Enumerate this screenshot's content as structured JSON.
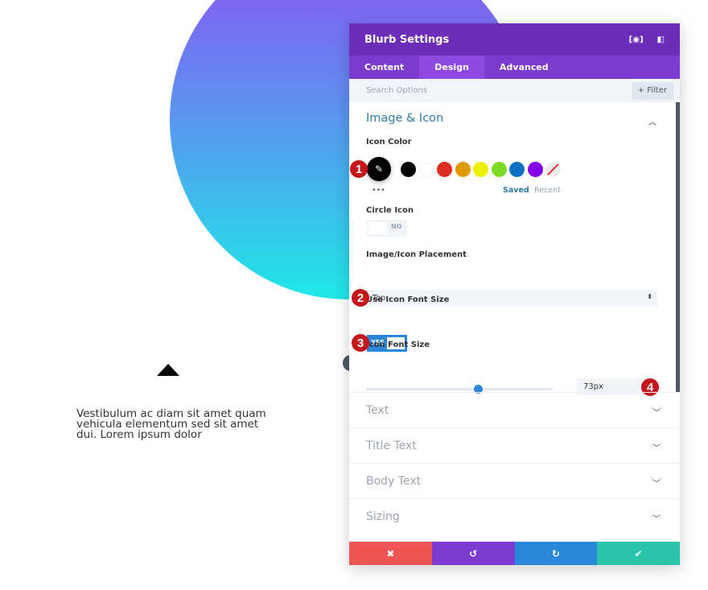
{
  "canvas": {
    "body_text": "Vestibulum ac diam sit amet quam vehicula elementum sed sit amet dui. Lorem ipsum dolor",
    "gradient_colors": [
      "#8f4ff5",
      "#1ee9e8"
    ]
  },
  "panel": {
    "title": "Blurb Settings",
    "header_icons": [
      "fullscreen-icon",
      "sidebar-toggle-icon"
    ],
    "tabs": [
      {
        "label": "Content"
      },
      {
        "label": "Design",
        "active": true
      },
      {
        "label": "Advanced"
      }
    ],
    "search_placeholder": "Search Options",
    "filter_label": "+ Filter",
    "section_title": "Image & Icon",
    "icon_color": {
      "label": "Icon Color",
      "swatches": [
        "#000000",
        "#ffffff",
        "#e02b20",
        "#e09900",
        "#edf000",
        "#7cda24",
        "#0c71c3",
        "#8300e9"
      ],
      "more": "•••",
      "saved": "Saved",
      "recent": "Recent"
    },
    "circle_icon": {
      "label": "Circle Icon",
      "value": "NO"
    },
    "placement": {
      "label": "Image/Icon Placement",
      "value": "Top"
    },
    "use_font_size": {
      "label": "Use Icon Font Size",
      "value": "YES"
    },
    "font_size": {
      "label": "Icon Font Size",
      "value": "73px",
      "slider_percent": 60
    },
    "badges": [
      "1",
      "2",
      "3",
      "4"
    ],
    "sections": [
      {
        "label": "Text"
      },
      {
        "label": "Title Text"
      },
      {
        "label": "Body Text"
      },
      {
        "label": "Sizing"
      }
    ],
    "footer": {
      "cancel": "✖",
      "undo": "↺",
      "redo": "↻",
      "save": "✔",
      "colors": [
        "#ef5555",
        "#7e3bd0",
        "#2b87da",
        "#29c4a9"
      ]
    }
  }
}
